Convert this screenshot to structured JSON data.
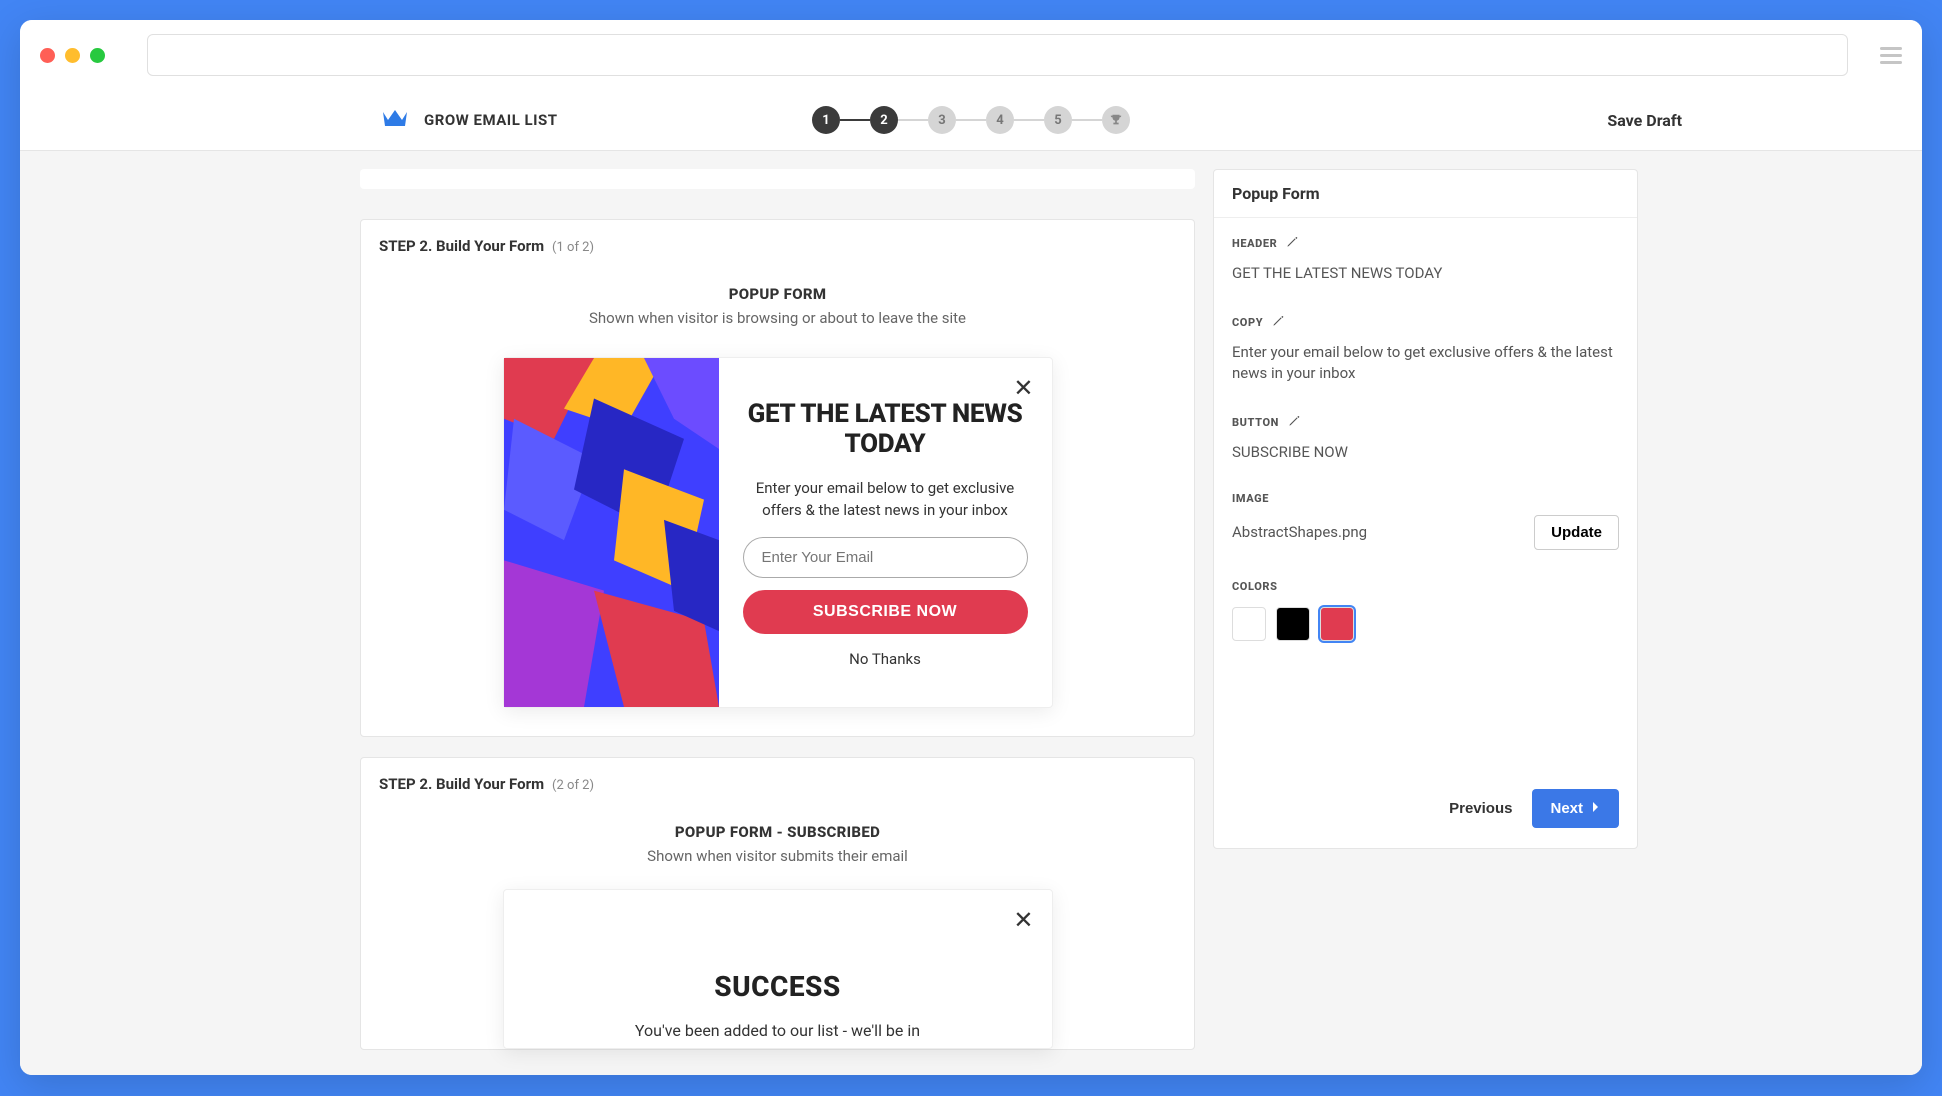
{
  "app": {
    "title": "GROW EMAIL LIST",
    "save_draft": "Save Draft"
  },
  "stepper": {
    "steps": [
      "1",
      "2",
      "3",
      "4",
      "5"
    ],
    "active_index": 1
  },
  "form1": {
    "card_title": "STEP 2. Build Your Form",
    "card_sub": "(1 of 2)",
    "heading": "POPUP FORM",
    "desc": "Shown when visitor is browsing or about to leave the site",
    "popup": {
      "headline": "GET THE LATEST NEWS TODAY",
      "copy": "Enter your email below to get exclusive offers & the latest news in your inbox",
      "placeholder": "Enter Your Email",
      "button": "SUBSCRIBE NOW",
      "nothanks": "No Thanks"
    }
  },
  "form2": {
    "card_title": "STEP 2. Build Your Form",
    "card_sub": "(2 of 2)",
    "heading": "POPUP FORM - SUBSCRIBED",
    "desc": "Shown when visitor submits their email",
    "success_title": "SUCCESS",
    "success_body": "You've been added to our list - we'll be in"
  },
  "sidebar": {
    "title": "Popup Form",
    "labels": {
      "header": "HEADER",
      "copy": "COPY",
      "button": "BUTTON",
      "image": "IMAGE",
      "colors": "COLORS"
    },
    "values": {
      "header": "GET THE LATEST NEWS TODAY",
      "copy": "Enter your email below to get exclusive offers & the latest news in your inbox",
      "button": "SUBSCRIBE NOW",
      "image_name": "AbstractShapes.png"
    },
    "update_label": "Update",
    "colors": [
      "#ffffff",
      "#000000",
      "#e03b50"
    ],
    "previous": "Previous",
    "next": "Next"
  }
}
